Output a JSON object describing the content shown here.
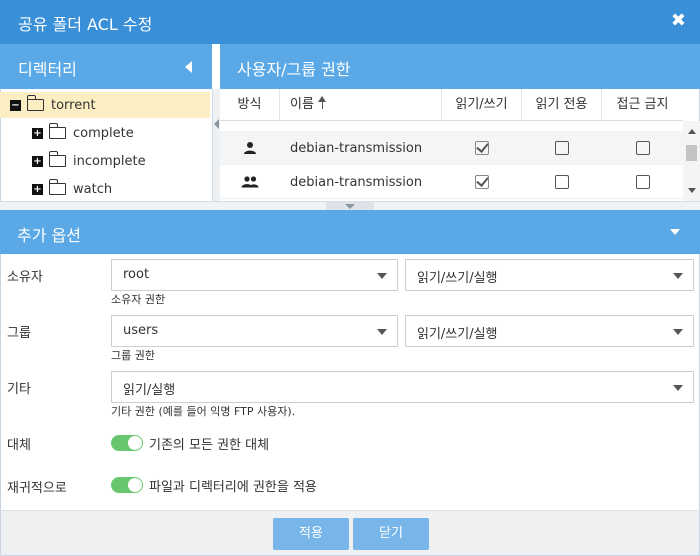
{
  "dialog": {
    "title": "공유 폴더 ACL 수정",
    "close_glyph": "✖"
  },
  "directory": {
    "header": "디렉터리",
    "tree": [
      {
        "name": "torrent",
        "expander": "−",
        "selected": true,
        "open": true
      },
      {
        "name": "complete",
        "expander": "+"
      },
      {
        "name": "incomplete",
        "expander": "+"
      },
      {
        "name": "watch",
        "expander": "+"
      }
    ]
  },
  "permissions": {
    "header": "사용자/그룹 권한",
    "columns": {
      "type": "방식",
      "name": "이름",
      "rw": "읽기/쓰기",
      "ro": "읽기 전용",
      "deny": "접근 금지"
    },
    "sort_icon": "sort-ascending-icon",
    "rows": [
      {
        "type_icon": "user-icon",
        "name": "debian-transmission",
        "rw": true,
        "ro": false,
        "deny": false
      },
      {
        "type_icon": "group-icon",
        "name": "debian-transmission",
        "rw": true,
        "ro": false,
        "deny": false
      }
    ]
  },
  "options": {
    "header": "추가 옵션",
    "owner": {
      "label": "소유자",
      "value": "root",
      "perm": "읽기/쓰기/실행",
      "hint": "소유자 권한"
    },
    "group": {
      "label": "그룹",
      "value": "users",
      "perm": "읽기/쓰기/실행",
      "hint": "그룹 권한"
    },
    "other": {
      "label": "기타",
      "perm": "읽기/실행",
      "hint": "기타 권한 (예를 들어 익명 FTP 사용자)."
    },
    "replace": {
      "label": "대체",
      "text": "기존의 모든 권한 대체",
      "enabled": true
    },
    "recursive": {
      "label": "재귀적으로",
      "text": "파일과 디렉터리에 권한을 적용",
      "enabled": true
    }
  },
  "footer": {
    "apply": "적용",
    "close": "닫기"
  },
  "colors": {
    "titlebar": "#3a8fd9",
    "panel_header": "#5aa9e6",
    "button": "#78b5e8",
    "switch_on": "#67c76e",
    "selected_row": "#fbeec2"
  }
}
